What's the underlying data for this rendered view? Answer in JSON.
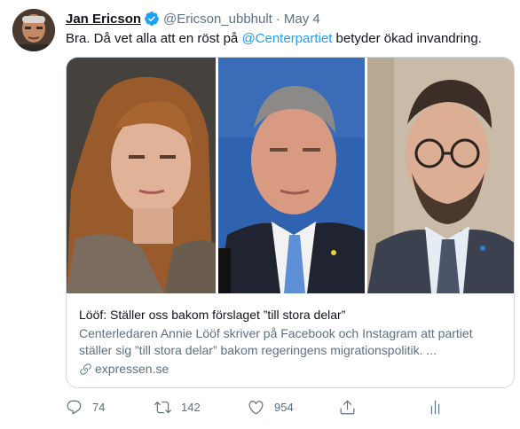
{
  "author": {
    "name": "Jan Ericson",
    "handle": "@Ericson_ubbhult",
    "separator": "·",
    "date": "May 4"
  },
  "tweet": {
    "text_before": "Bra. Då vet alla att en röst på ",
    "mention": "@Centerpartiet",
    "text_after": " betyder ökad invandring."
  },
  "card": {
    "title": "Lööf: Ställer oss bakom förslaget ”till stora delar”",
    "description": "Centerledaren Annie Lööf skriver på Facebook och Instagram att partiet ställer sig ”till stora delar” bakom regeringens migrationspolitik. ...",
    "domain": "expressen.se"
  },
  "actions": {
    "replies": "74",
    "retweets": "142",
    "likes": "954"
  },
  "colors": {
    "accent": "#1da1f2",
    "muted": "#5b7083",
    "border": "#cfd9de"
  },
  "icons": [
    "verified-badge-icon",
    "reply-icon",
    "retweet-icon",
    "like-icon",
    "share-icon",
    "analytics-icon",
    "link-icon"
  ]
}
